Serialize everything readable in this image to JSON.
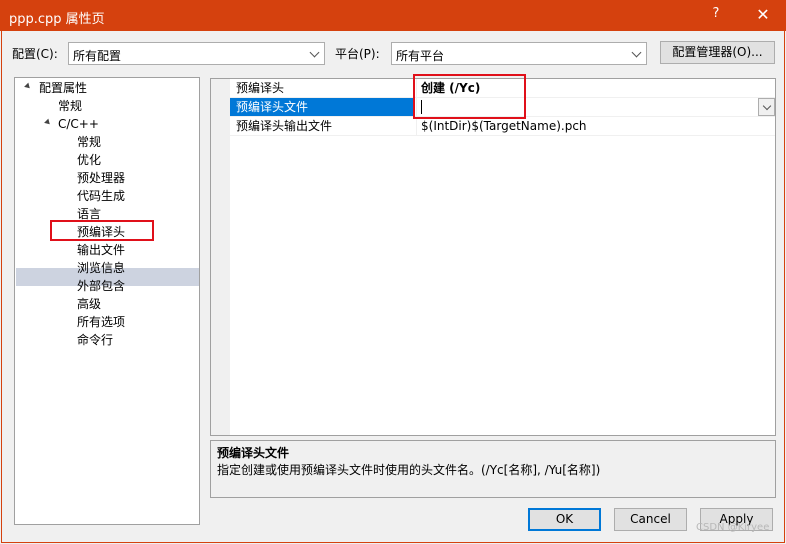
{
  "window": {
    "title": "ppp.cpp 属性页",
    "help": "?",
    "close": "✕"
  },
  "toolbar": {
    "config_label": "配置(C):",
    "config_value": "所有配置",
    "platform_label": "平台(P):",
    "platform_value": "所有平台",
    "config_manager": "配置管理器(O)..."
  },
  "tree": {
    "root": "配置属性",
    "general": "常规",
    "cpp": "C/C++",
    "cpp_children": [
      "常规",
      "优化",
      "预处理器",
      "代码生成",
      "语言",
      "预编译头",
      "输出文件",
      "浏览信息",
      "外部包含",
      "高级",
      "所有选项",
      "命令行"
    ]
  },
  "grid": {
    "rows": [
      {
        "name": "预编译头",
        "value": "创建 (/Yc)"
      },
      {
        "name": "预编译头文件",
        "value": ""
      },
      {
        "name": "预编译头输出文件",
        "value": "$(IntDir)$(TargetName).pch"
      }
    ]
  },
  "description": {
    "title": "预编译头文件",
    "text": "指定创建或使用预编译头文件时使用的头文件名。(/Yc[名称], /Yu[名称])"
  },
  "buttons": {
    "ok": "OK",
    "cancel": "Cancel",
    "apply": "Apply"
  },
  "watermark": "CSDN @Kiryee"
}
